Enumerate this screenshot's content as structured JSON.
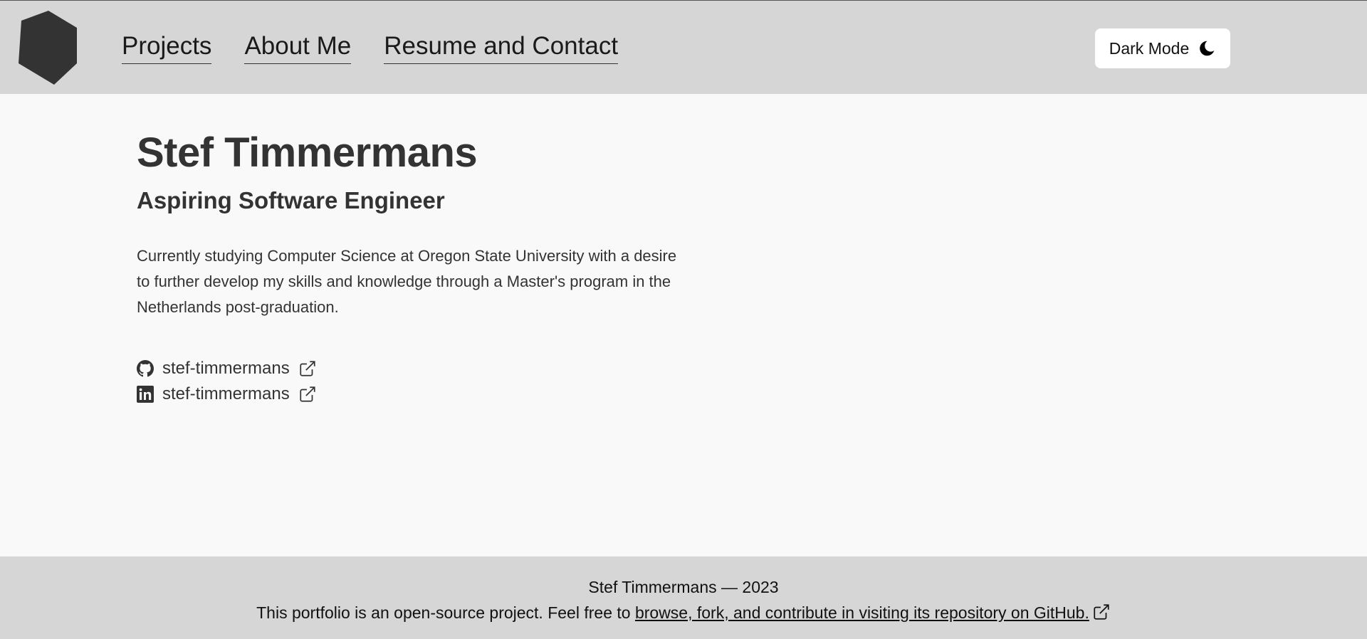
{
  "header": {
    "logo_icon": "hexagon-logo-icon",
    "nav": [
      {
        "label": "Projects"
      },
      {
        "label": "About Me"
      },
      {
        "label": "Resume and Contact"
      }
    ],
    "mode_button": {
      "label": "Dark Mode",
      "icon": "moon-icon"
    }
  },
  "main": {
    "name": "Stef Timmermans",
    "title": "Aspiring Software Engineer",
    "bio": "Currently studying Computer Science at Oregon State University with a desire to further develop my skills and knowledge through a Master's program in the Netherlands post-graduation.",
    "links": [
      {
        "icon": "github-icon",
        "label": "stef-timmermans"
      },
      {
        "icon": "linkedin-icon",
        "label": "stef-timmermans"
      }
    ]
  },
  "footer": {
    "line1": "Stef Timmermans — 2023",
    "line2_prefix": "This portfolio is an open-source project. Feel free to ",
    "line2_link": "browse, fork, and contribute in visiting its repository on GitHub."
  },
  "colors": {
    "header_bg": "#d6d6d6",
    "page_bg": "#f9f9f9",
    "text": "#333333",
    "logo": "#333333"
  }
}
